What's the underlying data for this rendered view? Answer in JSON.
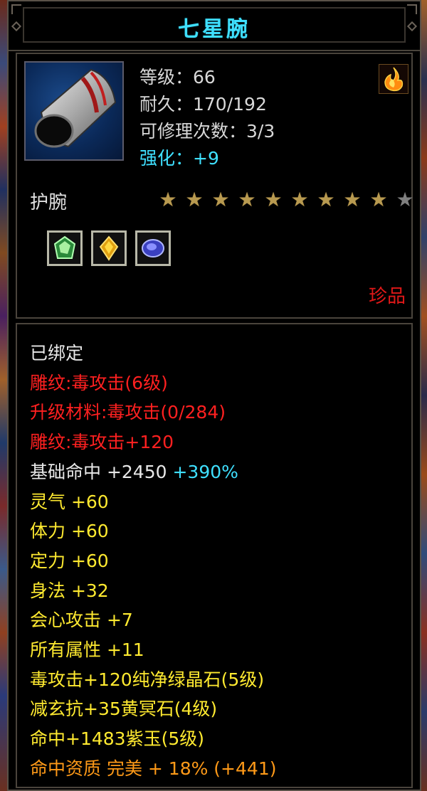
{
  "item": {
    "name": "七星腕",
    "level": "等级：66",
    "durability": "耐久：170/192",
    "repairs": "可修理次数：3/3",
    "enhance": "强化：+9",
    "type": "护腕",
    "stars_filled": 9,
    "stars_total": 10,
    "rarity": "珍品"
  },
  "icons": {
    "item": "bracer-icon",
    "element": "fire-icon",
    "gems": [
      "green-crystal-gem-icon",
      "yellow-gem-icon",
      "purple-jade-gem-icon"
    ]
  },
  "attributes": {
    "bound": "已绑定",
    "engraving": "雕纹:毒攻击(6级)",
    "upgrade_material": "升级材料:毒攻击(0/284)",
    "engraving_bonus": "雕纹:毒攻击+120",
    "hit_label": "基础命中 +2450",
    "hit_pct": "+390%",
    "spirit": "灵气 +60",
    "stamina": "体力 +60",
    "focus": "定力 +60",
    "agility": "身法 +32",
    "crit": "会心攻击 +7",
    "all_attr": "所有属性 +11",
    "gem1": "毒攻击+120纯净绿晶石(5级)",
    "gem2": "减玄抗+35黄冥石(4级)",
    "gem3": "命中+1483紫玉(5级)",
    "quality": "命中资质 完美 + 18% (+441)"
  },
  "colors": {
    "title": "#3fe0ff",
    "red_text": "#ff2020",
    "yellow_text": "#ffea30",
    "orange_text": "#ff9a18",
    "cyan_text": "#3fe0ff"
  }
}
